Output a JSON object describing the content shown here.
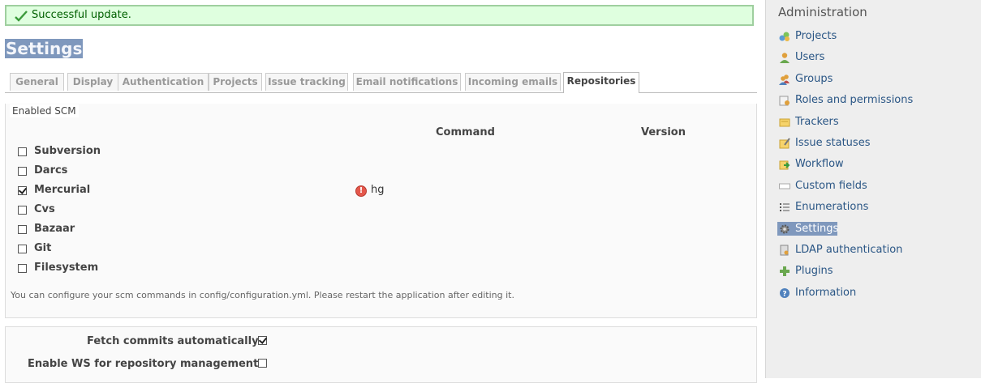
{
  "flash": {
    "message": "Successful update."
  },
  "page": {
    "title": "Settings"
  },
  "tabs": [
    {
      "label": "General"
    },
    {
      "label": "Display"
    },
    {
      "label": "Authentication"
    },
    {
      "label": "Projects"
    },
    {
      "label": "Issue tracking"
    },
    {
      "label": "Email notifications"
    },
    {
      "label": "Incoming emails"
    },
    {
      "label": "Repositories",
      "selected": true
    }
  ],
  "scm": {
    "legend": "Enabled SCM",
    "headers": {
      "command": "Command",
      "version": "Version"
    },
    "rows": [
      {
        "name": "Subversion",
        "checked": false
      },
      {
        "name": "Darcs",
        "checked": false
      },
      {
        "name": "Mercurial",
        "checked": true,
        "command": "hg"
      },
      {
        "name": "Cvs",
        "checked": false
      },
      {
        "name": "Bazaar",
        "checked": false
      },
      {
        "name": "Git",
        "checked": false
      },
      {
        "name": "Filesystem",
        "checked": false
      }
    ],
    "note": "You can configure your scm commands in config/configuration.yml. Please restart the application after editing it."
  },
  "options": {
    "fetch_commits": {
      "label": "Fetch commits automatically",
      "checked": true
    },
    "enable_ws": {
      "label": "Enable WS for repository management",
      "checked": false
    }
  },
  "sidebar": {
    "title": "Administration",
    "items": [
      {
        "label": "Projects",
        "icon": "projects-icon"
      },
      {
        "label": "Users",
        "icon": "user-icon"
      },
      {
        "label": "Groups",
        "icon": "group-icon"
      },
      {
        "label": "Roles and permissions",
        "icon": "roles-icon"
      },
      {
        "label": "Trackers",
        "icon": "tracker-icon"
      },
      {
        "label": "Issue statuses",
        "icon": "issue-status-icon"
      },
      {
        "label": "Workflow",
        "icon": "workflow-icon"
      },
      {
        "label": "Custom fields",
        "icon": "custom-field-icon"
      },
      {
        "label": "Enumerations",
        "icon": "list-icon"
      },
      {
        "label": "Settings",
        "icon": "gear-icon",
        "selected": true
      },
      {
        "label": "LDAP authentication",
        "icon": "server-key-icon"
      },
      {
        "label": "Plugins",
        "icon": "plugin-icon"
      },
      {
        "label": "Information",
        "icon": "help-icon"
      }
    ]
  }
}
